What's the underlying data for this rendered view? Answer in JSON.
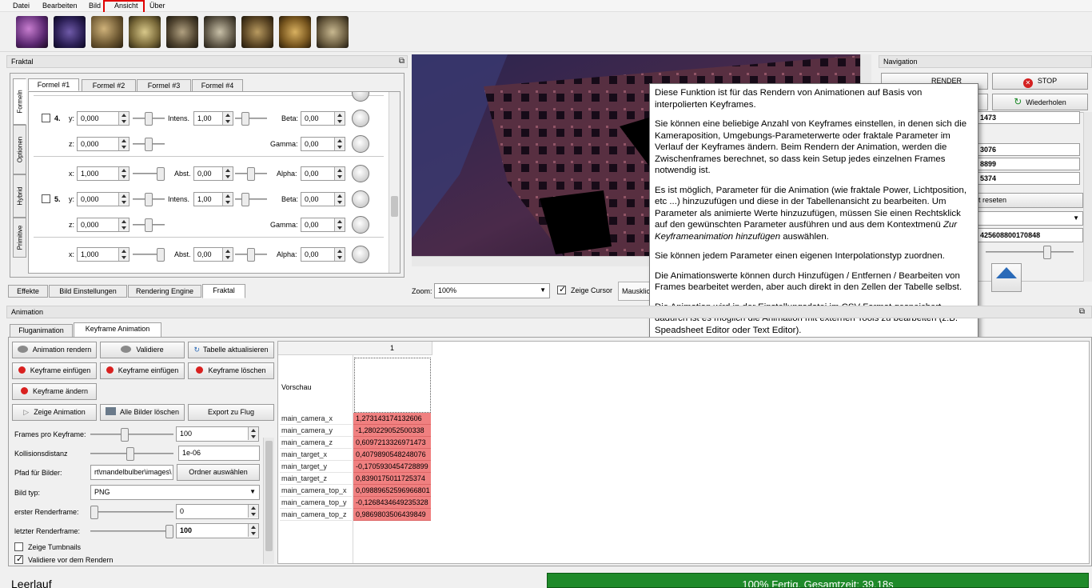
{
  "menu": {
    "items": [
      "Datei",
      "Bearbeiten",
      "Bild",
      "Ansicht",
      "Über"
    ]
  },
  "fractal_dock": {
    "title": "Fraktal",
    "formula_tabs": [
      "Formel #1",
      "Formel #2",
      "Formel #3",
      "Formel #4"
    ],
    "side_tabs": [
      "Formeln",
      "Optionen",
      "Hybrid",
      "Primitive"
    ],
    "row4": {
      "num": "4.",
      "y_label": "y:",
      "y_val": "0,000",
      "intens_label": "Intens.",
      "intens_val": "1,00",
      "beta_label": "Beta:",
      "beta_val": "0,00",
      "z_label": "z:",
      "z_val": "0,000",
      "gamma_label": "Gamma:",
      "gamma_val": "0,00"
    },
    "row5x": {
      "x_label": "x:",
      "x_val": "1,000",
      "abst_label": "Abst.",
      "abst_val": "0,00",
      "alpha_label": "Alpha:",
      "alpha_val": "0,00"
    },
    "row5": {
      "num": "5.",
      "y_label": "y:",
      "y_val": "0,000",
      "intens_label": "Intens.",
      "intens_val": "1,00",
      "beta_label": "Beta:",
      "beta_val": "0,00",
      "z_label": "z:",
      "z_val": "0,000",
      "gamma_label": "Gamma:",
      "gamma_val": "0,00"
    },
    "row6x": {
      "x_label": "x:",
      "x_val": "1,000",
      "abst_label": "Abst.",
      "abst_val": "0,00",
      "alpha_label": "Alpha:",
      "alpha_val": "0,00"
    },
    "bottom_tabs": [
      "Effekte",
      "Bild Einstellungen",
      "Rendering Engine",
      "Fraktal"
    ]
  },
  "viewport": {
    "zoom_label": "Zoom:",
    "zoom_val": "100%",
    "cursor_label": "Zeige Cursor",
    "mouse_label": "Mausklick"
  },
  "navigation": {
    "title": "Navigation",
    "render_label": "RENDER",
    "stop_label": "STOP",
    "repeat_label": "Wiederholen",
    "val1": "1473",
    "val2": "3076",
    "val3": "8899",
    "val4": "5374",
    "reset_label": "t reseten",
    "long_val": "425608800170848"
  },
  "tooltip": {
    "p1": "Diese Funktion ist für das Rendern von Animationen auf Basis von interpolierten Keyframes.",
    "p2": "Sie können eine beliebige Anzahl von Keyframes einstellen, in denen sich die Kameraposition, Umgebungs-Parameterwerte oder fraktale Parameter im Verlauf der Keyframes ändern. Beim Rendern der Animation, werden die Zwischenframes berechnet, so dass kein Setup jedes einzelnen Frames notwendig ist.",
    "p3a": "Es ist möglich, Parameter für die Animation (wie fraktale Power, Lichtposition, etc ...) hinzuzufügen und diese in der Tabellenansicht zu bearbeiten. Um Parameter als animierte Werte hinzuzufügen, müssen Sie einen Rechtsklick auf den gewünschten Parameter ausführen und aus dem Kontextmenü ",
    "p3b": "Zur Keyframeanimation hinzufügen",
    "p3c": " auswählen.",
    "p4": "Sie können jedem Parameter einen eigenen Interpolationstyp zuordnen.",
    "p5": "Die Animationswerte können durch Hinzufügen / Entfernen / Bearbeiten von Frames bearbeitet werden, aber auch direkt in den Zellen der Tabelle selbst.",
    "p6": "Die Animation wird in der Einstellungsdatei im CSV Format gespeichert, dadurch ist es möglich die Animation mit externen Tools zu bearbeiten (z.B. Speadsheet Editor oder Text Editor)."
  },
  "animation": {
    "title": "Animation",
    "tabs": [
      "Fluganimation",
      "Keyframe Animation"
    ],
    "buttons": {
      "render": "Animation rendern",
      "validate": "Validiere",
      "refresh": "Tabelle aktualisieren",
      "kf_insert1": "Keyframe einfügen",
      "kf_insert2": "Keyframe einfügen",
      "kf_delete": "Keyframe löschen",
      "kf_change": "Keyframe ändern",
      "show_anim": "Zeige Animation",
      "delete_all": "Alle Bilder löschen",
      "export": "Export zu Flug",
      "choose_folder": "Ordner auswählen"
    },
    "fields": {
      "frames_label": "Frames pro Keyframe:",
      "frames_val": "100",
      "collision_label": "Kollisionsdistanz",
      "collision_val": "1e-06",
      "path_label": "Pfad für Bilder:",
      "path_val": "rt\\mandelbulber\\images\\",
      "type_label": "Bild typ:",
      "type_val": "PNG",
      "first_label": "erster Renderframe:",
      "first_val": "0",
      "last_label": "letzter  Renderframe:",
      "last_val": "100",
      "thumbs_label": "Zeige Tumbnails",
      "validate_label": "Validiere vor dem Rendern"
    },
    "table": {
      "col_header": "1",
      "preview_label": "Vorschau",
      "rows": [
        {
          "label": "main_camera_x",
          "value": "1,273143174132606"
        },
        {
          "label": "main_camera_y",
          "value": "-1,280229052500338"
        },
        {
          "label": "main_camera_z",
          "value": "0,6097213326971473"
        },
        {
          "label": "main_target_x",
          "value": "0,4079890548248076"
        },
        {
          "label": "main_target_y",
          "value": "-0,1705930454728899"
        },
        {
          "label": "main_target_z",
          "value": "0,8390175011725374"
        },
        {
          "label": "main_camera_top_x",
          "value": "0,09889652596966801"
        },
        {
          "label": "main_camera_top_y",
          "value": "-0,1268434649235328"
        },
        {
          "label": "main_camera_top_z",
          "value": "0,9869803506439849"
        }
      ]
    }
  },
  "status": {
    "idle": "Leerlauf",
    "progress_text": "100% Fertig, Gesamtzeit: 39,18s",
    "progress": 1.0
  },
  "colors": {
    "accent_red": "#e00000",
    "progress_green": "#1f8a2a",
    "cell_red": "#f08080"
  }
}
